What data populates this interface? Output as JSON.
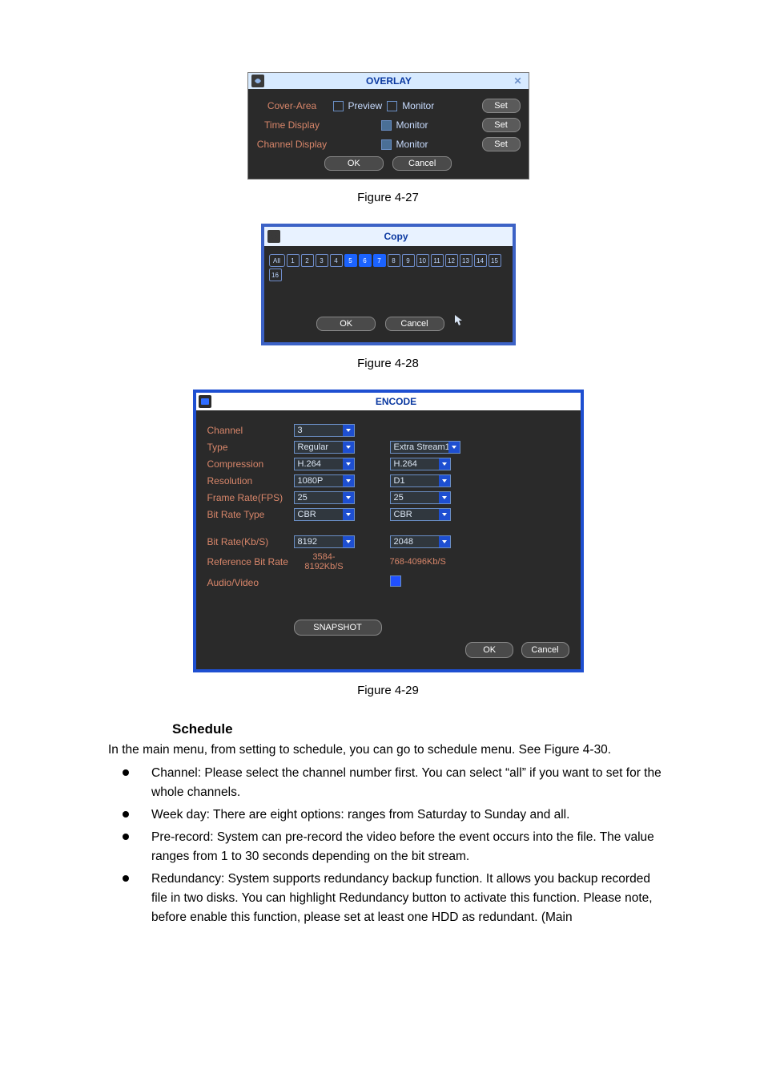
{
  "overlay": {
    "title": "OVERLAY",
    "close_glyph": "✕",
    "rows": {
      "cover": {
        "label": "Cover-Area",
        "cb1_text": "Preview",
        "cb2_text": "Monitor",
        "set": "Set"
      },
      "time": {
        "label": "Time Display",
        "cb_text": "Monitor",
        "set": "Set"
      },
      "chan": {
        "label": "Channel Display",
        "cb_text": "Monitor",
        "set": "Set"
      }
    },
    "ok": "OK",
    "cancel": "Cancel"
  },
  "captions": {
    "fig27": "Figure 4-27",
    "fig28": "Figure 4-28",
    "fig29": "Figure 4-29"
  },
  "copy": {
    "title": "Copy",
    "all_label": "All",
    "channels": [
      "1",
      "2",
      "3",
      "4",
      "5",
      "6",
      "7",
      "8",
      "9",
      "10",
      "11",
      "12",
      "13",
      "14",
      "15",
      "16"
    ],
    "selected": [
      "5",
      "6",
      "7"
    ],
    "ok": "OK",
    "cancel": "Cancel"
  },
  "encode": {
    "title": "ENCODE",
    "labels": {
      "channel": "Channel",
      "type": "Type",
      "compression": "Compression",
      "resolution": "Resolution",
      "fps": "Frame Rate(FPS)",
      "brtype": "Bit Rate Type",
      "br": "Bit Rate(Kb/S)",
      "ref": "Reference Bit Rate",
      "av": "Audio/Video"
    },
    "main": {
      "channel": "3",
      "type": "Regular",
      "compression": "H.264",
      "resolution": "1080P",
      "fps": "25",
      "brtype": "CBR",
      "br": "8192",
      "ref": "3584-8192Kb/S"
    },
    "extra": {
      "type": "Extra Stream1",
      "compression": "H.264",
      "resolution": "D1",
      "fps": "25",
      "brtype": "CBR",
      "br": "2048",
      "ref": "768-4096Kb/S"
    },
    "snapshot": "SNAPSHOT",
    "ok": "OK",
    "cancel": "Cancel"
  },
  "schedule": {
    "heading": "Schedule",
    "intro": "In the main menu, from setting to schedule, you can go to schedule menu. See Figure 4-30.",
    "bullets": [
      "Channel: Please select the channel number first. You can select “all” if you want to set for the whole channels.",
      "Week day: There are eight options: ranges from Saturday to Sunday and all.",
      "Pre-record: System can pre-record the video before the event occurs into the file. The value ranges from 1 to 30 seconds depending on the bit stream.",
      "Redundancy: System supports redundancy backup function.   It allows you backup recorded file in two disks. You can highlight Redundancy button to activate this function. Please note, before enable this function, please set at least one HDD as redundant. (Main"
    ]
  }
}
